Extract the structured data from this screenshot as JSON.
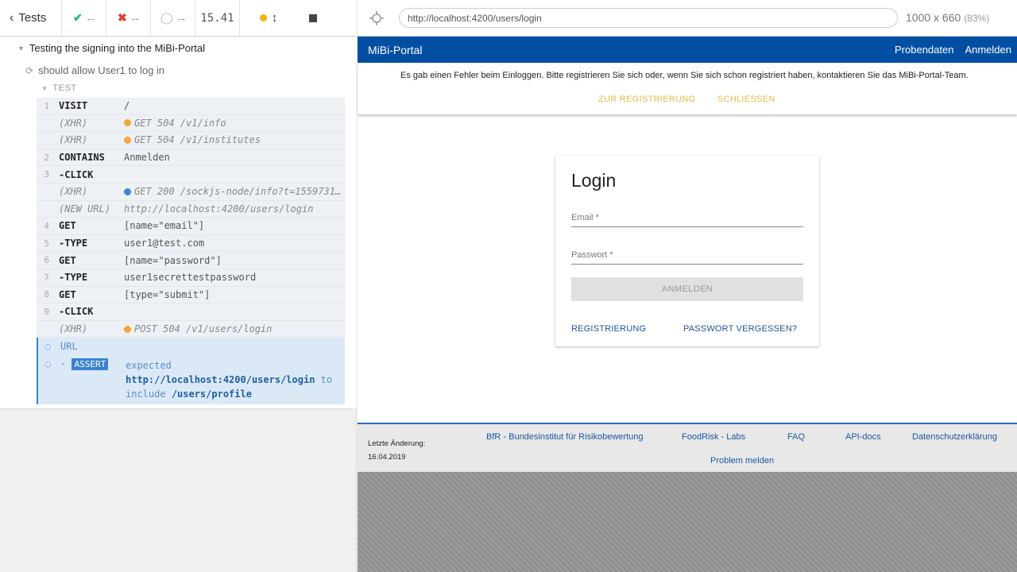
{
  "runner": {
    "tests_label": "Tests",
    "passed": "--",
    "failed": "--",
    "pending": "--",
    "duration": "15.41",
    "suite_title": "Testing the signing into the MiBi-Portal",
    "test_title": "should allow User1 to log in",
    "test_header": "TEST",
    "commands": [
      {
        "num": "1",
        "name": "VISIT",
        "msg": "/",
        "kind": "cmd"
      },
      {
        "num": "",
        "name": "(XHR)",
        "msg": "GET 504 /v1/info",
        "kind": "xhr",
        "dot": "#f5a53a"
      },
      {
        "num": "",
        "name": "(XHR)",
        "msg": "GET 504 /v1/institutes",
        "kind": "xhr",
        "dot": "#f5a53a"
      },
      {
        "num": "2",
        "name": "CONTAINS",
        "msg": "Anmelden",
        "kind": "cmd"
      },
      {
        "num": "3",
        "name": "-CLICK",
        "msg": "",
        "kind": "sub"
      },
      {
        "num": "",
        "name": "(XHR)",
        "msg": "GET 200 /sockjs-node/info?t=1559731…",
        "kind": "xhr",
        "dot": "#3b86d8"
      },
      {
        "num": "",
        "name": "(NEW URL)",
        "msg": "http://localhost:4200/users/login",
        "kind": "xhr"
      },
      {
        "num": "4",
        "name": "GET",
        "msg": "[name=\"email\"]",
        "kind": "cmd"
      },
      {
        "num": "5",
        "name": "-TYPE",
        "msg": "user1@test.com",
        "kind": "sub"
      },
      {
        "num": "6",
        "name": "GET",
        "msg": "[name=\"password\"]",
        "kind": "cmd"
      },
      {
        "num": "7",
        "name": "-TYPE",
        "msg": "user1secrettestpassword",
        "kind": "sub"
      },
      {
        "num": "8",
        "name": "GET",
        "msg": "[type=\"submit\"]",
        "kind": "cmd"
      },
      {
        "num": "9",
        "name": "-CLICK",
        "msg": "",
        "kind": "sub"
      },
      {
        "num": "",
        "name": "(XHR)",
        "msg": "POST 504 /v1/users/login",
        "kind": "xhr",
        "dot": "#f5a53a"
      }
    ],
    "assert": {
      "url_label": "URL",
      "assert_label": "ASSERT",
      "expected": "expected",
      "actual": "http://localhost:4200/users/login",
      "to": "to",
      "include": "include",
      "target": "/users/profile"
    }
  },
  "browser": {
    "url": "http://localhost:4200/users/login",
    "size": "1000 x 660",
    "scale": "(83%)"
  },
  "app": {
    "brand": "MiBi-Portal",
    "nav": [
      "Probendaten",
      "Anmelden"
    ],
    "error_text": "Es gab einen Fehler beim Einloggen. Bitte registrieren Sie sich oder, wenn Sie sich schon registriert haben, kontaktieren Sie das MiBi-Portal-Team.",
    "to_register": "ZUR REGISTRIERUNG",
    "close": "SCHLIESSEN",
    "login_title": "Login",
    "email_placeholder": "Email *",
    "password_placeholder": "Passwort *",
    "submit": "ANMELDEN",
    "register_link": "REGISTRIERUNG",
    "forgot_link": "PASSWORT VERGESSEN?",
    "footer": {
      "last_change_label": "Letzte Änderung:",
      "last_change_date": "16.04.2019",
      "links": [
        "BfR - Bundesinstitut für Risikobewertung",
        "FoodRisk - Labs",
        "FAQ",
        "API-docs",
        "Datenschutzerklärung",
        "Problem melden"
      ]
    }
  },
  "colors": {
    "brand_blue": "#004fa3",
    "warn_yellow": "#e8b84a",
    "pass_green": "#1fbf72",
    "fail_red": "#e0403a"
  }
}
